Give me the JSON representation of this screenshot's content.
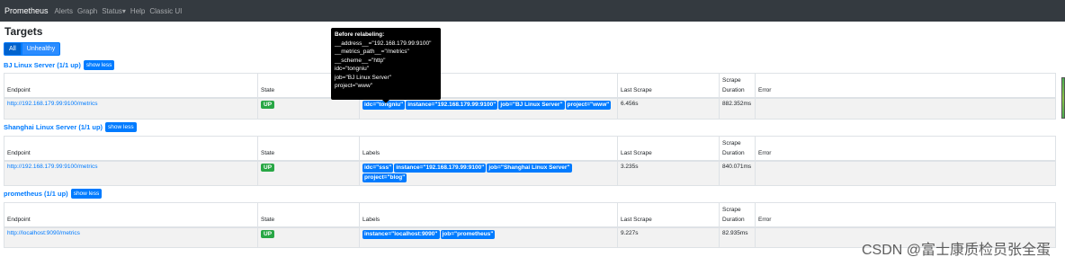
{
  "nav": {
    "brand": "Prometheus",
    "links": [
      "Alerts",
      "Graph",
      "Status▾",
      "Help",
      "Classic UI"
    ]
  },
  "page_title": "Targets",
  "filters": {
    "all": "All",
    "unhealthy": "Unhealthy"
  },
  "columns": {
    "endpoint": "Endpoint",
    "state": "State",
    "labels": "Labels",
    "last_scrape": "Last Scrape",
    "scrape_duration": [
      "Scrape",
      "Duration"
    ],
    "error": "Error"
  },
  "pools": [
    {
      "name": "BJ Linux Server (1/1 up)",
      "toggle": "show less",
      "endpoint": "http://192.168.179.99:9100/metrics",
      "state": "UP",
      "labels": [
        "idc=\"tongniu\"",
        "instance=\"192.168.179.99:9100\"",
        "job=\"BJ Linux Server\"",
        "project=\"www\""
      ],
      "last_scrape": "6.456s",
      "duration": "882.352ms",
      "error": ""
    },
    {
      "name": "Shanghai Linux Server (1/1 up)",
      "toggle": "show less",
      "endpoint": "http://192.168.179.99:9100/metrics",
      "state": "UP",
      "labels": [
        "idc=\"sss\"",
        "instance=\"192.168.179.99:9100\"",
        "job=\"Shanghai Linux Server\"",
        "project=\"blog\""
      ],
      "last_scrape": "3.235s",
      "duration": "840.071ms",
      "error": ""
    },
    {
      "name": "prometheus (1/1 up)",
      "toggle": "show less",
      "endpoint": "http://localhost:9090/metrics",
      "state": "UP",
      "labels": [
        "instance=\"localhost:9090\"",
        "job=\"prometheus\""
      ],
      "last_scrape": "9.227s",
      "duration": "82.935ms",
      "error": ""
    }
  ],
  "tooltip": {
    "title": "Before relabeling:",
    "lines": [
      "__address__=\"192.168.179.99:9100\"",
      "__metrics_path__=\"/metrics\"",
      "__scheme__=\"http\"",
      "idc=\"tongniu\"",
      "job=\"BJ Linux Server\"",
      "project=\"www\""
    ]
  },
  "watermark": "CSDN @富士康质检员张全蛋"
}
